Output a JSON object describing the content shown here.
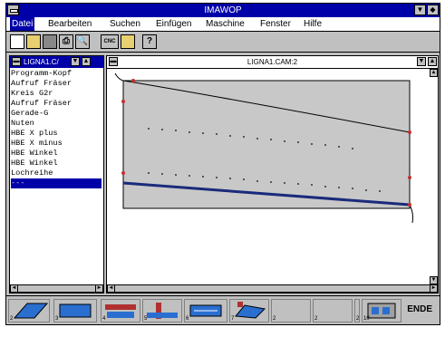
{
  "window": {
    "title": "IMAWOP"
  },
  "menu": [
    "Datei",
    "Bearbeiten",
    "Suchen",
    "Einfügen",
    "Maschine",
    "Fenster",
    "Hilfe"
  ],
  "toolbar": {
    "cnc_label": "CNC",
    "help_label": "?"
  },
  "left_pane": {
    "title": "LIGNA1.C/",
    "items": [
      "Programm-Kopf",
      "Aufruf Fräser",
      "Kreis G2r",
      "Aufruf Fräser",
      "Gerade-G",
      "Nuten",
      "HBE X plus",
      "HBE X minus",
      "HBE Winkel",
      "HBE Winkel",
      "Lochreihe",
      "---"
    ],
    "selected_index": 11
  },
  "right_pane": {
    "title": "LIGNA1.CAM:2"
  },
  "bottom_buttons": [
    "2",
    "3",
    "4",
    "5",
    "6",
    "7",
    "2",
    "2",
    "2",
    "10"
  ],
  "ende_label": "ENDE"
}
